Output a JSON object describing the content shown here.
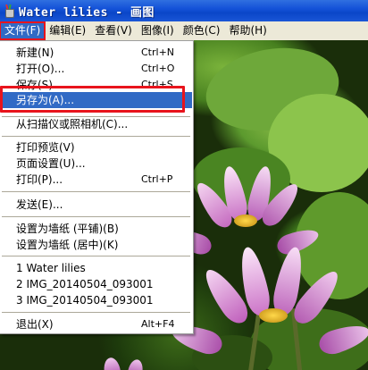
{
  "window": {
    "title": "Water lilies - 画图",
    "icon": "paint-app-icon"
  },
  "menubar": {
    "items": [
      "文件(F)",
      "编辑(E)",
      "查看(V)",
      "图像(I)",
      "颜色(C)",
      "帮助(H)"
    ],
    "active": "文件(F)"
  },
  "file_menu": {
    "new": {
      "label": "新建(N)",
      "key": "Ctrl+N"
    },
    "open": {
      "label": "打开(O)...",
      "key": "Ctrl+O"
    },
    "save": {
      "label": "保存(S)",
      "key": "Ctrl+S"
    },
    "save_as": {
      "label": "另存为(A)..."
    },
    "from_scanner": {
      "label": "从扫描仪或照相机(C)..."
    },
    "print_preview": {
      "label": "打印预览(V)"
    },
    "page_setup": {
      "label": "页面设置(U)..."
    },
    "print": {
      "label": "打印(P)...",
      "key": "Ctrl+P"
    },
    "send": {
      "label": "发送(E)..."
    },
    "wallpaper_tiled": {
      "label": "设置为墙纸 (平铺)(B)"
    },
    "wallpaper_centered": {
      "label": "设置为墙纸 (居中)(K)"
    },
    "recent": [
      {
        "label": "1 Water lilies"
      },
      {
        "label": "2 IMG_20140504_093001"
      },
      {
        "label": "3 IMG_20140504_093001"
      }
    ],
    "exit": {
      "label": "退出(X)",
      "key": "Alt+F4"
    }
  },
  "colors": {
    "titlebar": "#0a46c8",
    "menu_highlight": "#316ac5",
    "annotation_red": "#e8141c",
    "menubar_bg": "#ece9d8"
  }
}
